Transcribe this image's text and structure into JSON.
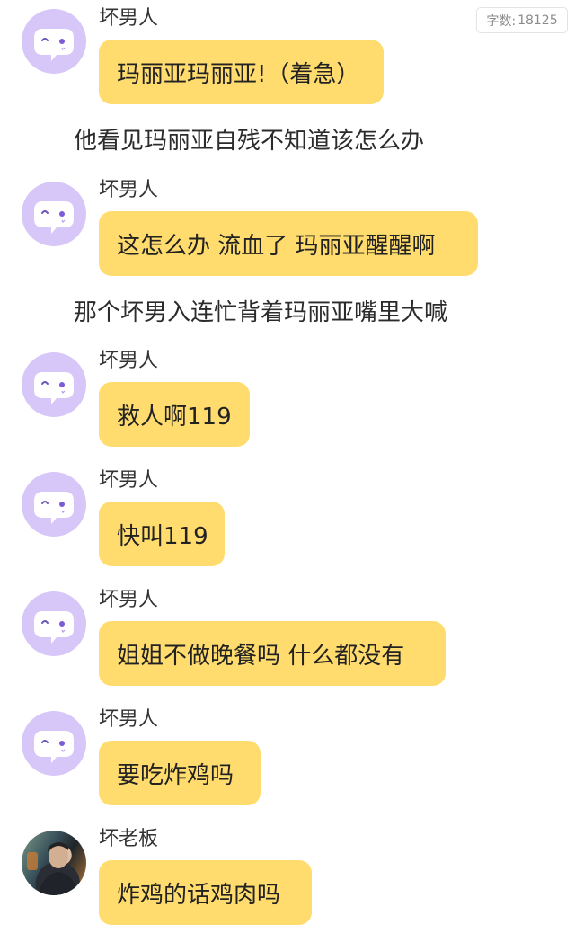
{
  "word_count": {
    "label": "字数:",
    "value": "18125"
  },
  "messages": [
    {
      "speaker": "坏男人",
      "text": "玛丽亚玛丽亚!（着急）",
      "avatar": "chat-bubble-icon"
    },
    {
      "narration": "他看见玛丽亚自残不知道该怎么办"
    },
    {
      "speaker": "坏男人",
      "text": "这怎么办 流血了 玛丽亚醒醒啊",
      "avatar": "chat-bubble-icon"
    },
    {
      "narration": "那个坏男入连忙背着玛丽亚嘴里大喊"
    },
    {
      "speaker": "坏男人",
      "text": "救人啊119",
      "avatar": "chat-bubble-icon"
    },
    {
      "speaker": "坏男人",
      "text": "快叫119",
      "avatar": "chat-bubble-icon"
    },
    {
      "speaker": "坏男人",
      "text": "姐姐不做晚餐吗 什么都没有",
      "avatar": "chat-bubble-icon"
    },
    {
      "speaker": "坏男人",
      "text": "要吃炸鸡吗",
      "avatar": "chat-bubble-icon"
    },
    {
      "speaker": "坏老板",
      "text": "炸鸡的话鸡肉吗",
      "avatar": "photo-avatar"
    }
  ],
  "colors": {
    "bubble": "#ffdc6d",
    "bot_avatar": "#d7c6f8",
    "background": "#ffffff"
  }
}
